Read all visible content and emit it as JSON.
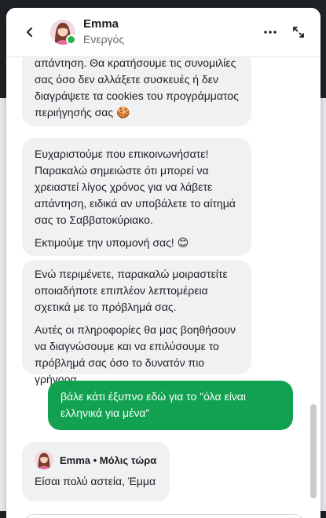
{
  "header": {
    "agent_name": "Emma",
    "agent_status": "Ενεργός",
    "back_icon": "chevron-left-icon",
    "menu_icon": "more-horizontal-icon",
    "expand_icon": "expand-icon"
  },
  "messages": {
    "m1": "απάντηση. Θα κρατήσουμε τις συνομιλίες σας όσο δεν αλλάξετε συσκευές ή δεν διαγράψετε τα cookies του προγράμματος περιήγησής σας 🍪",
    "m2_p1": "Ευχαριστούμε που επικοινωνήσατε! Παρακαλώ σημειώστε ότι μπορεί να χρειαστεί λίγος χρόνος για να λάβετε απάντηση, ειδικά αν υποβάλετε το αίτημά σας το Σαββατοκύριακο.",
    "m2_p2": "Εκτιμούμε την υπομονή σας! 😊",
    "m3_p1": "Ενώ περιμένετε, παρακαλώ μοιραστείτε οποιαδήποτε επιπλέον λεπτομέρεια σχετικά με το πρόβλημά σας.",
    "m3_p2": "Αυτές οι πληροφορίες θα μας βοηθήσουν να διαγνώσουμε και να επιλύσουμε το πρόβλημά σας όσο το δυνατόν πιο γρήγορα.",
    "user_msg": "βάλε κάτι έξυπνο εδώ για το \"όλα είναι ελληνικά για μένα\"",
    "last_author": "Emma • Μόλις τώρα",
    "last_text": "Είσαι πολύ αστεία, Έμμα"
  },
  "colors": {
    "accent_green": "#12a150",
    "online_green": "#2bb24c",
    "incoming_bubble": "#f0f1f3"
  }
}
